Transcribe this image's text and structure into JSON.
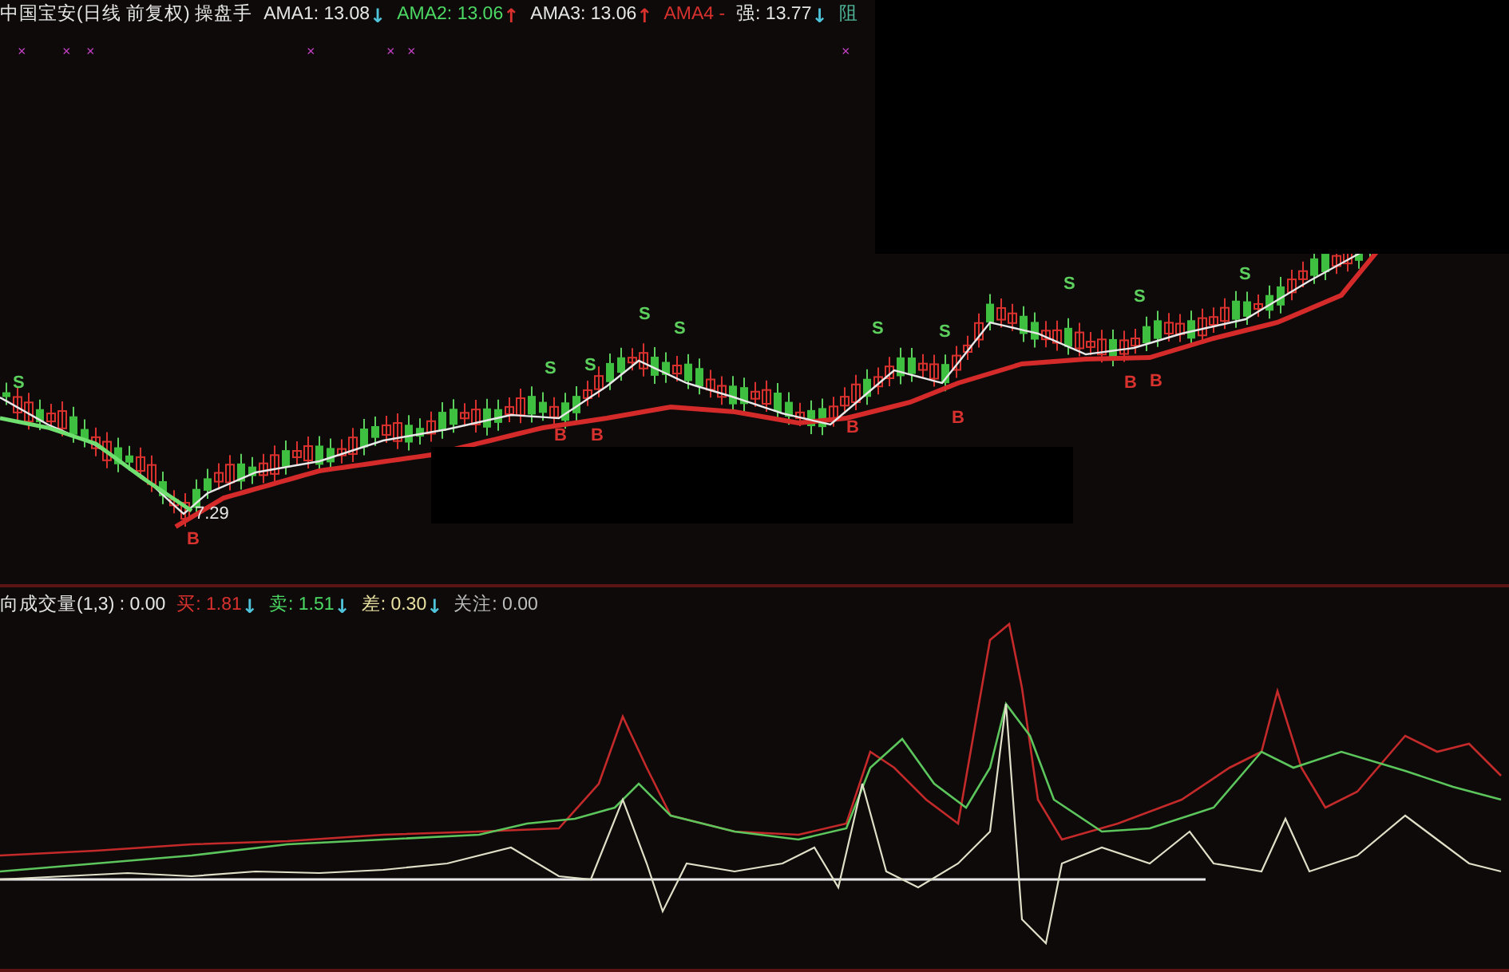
{
  "header": {
    "title": "中国宝安(日线 前复权) 操盘手",
    "indicators": [
      {
        "label": "AMA1: 13.08",
        "color": "#e6e6e6",
        "arrow": {
          "text": "↓",
          "color": "#4fc3d9"
        }
      },
      {
        "label": "AMA2: 13.06",
        "color": "#4cd964",
        "arrow": {
          "text": "↑",
          "color": "#d9322e"
        }
      },
      {
        "label": "AMA3: 13.06",
        "color": "#e6e6e6",
        "arrow": {
          "text": "↑",
          "color": "#d9322e"
        }
      },
      {
        "label": "AMA4 -",
        "color": "#d9322e"
      },
      {
        "label": "强: 13.77",
        "color": "#e6e6e6",
        "arrow": {
          "text": "↓",
          "color": "#4fc3d9"
        }
      },
      {
        "label": "阻",
        "color": "#4fb89a"
      }
    ]
  },
  "price_chart": {
    "low_label": "7.29",
    "markers": [
      {
        "text": "×"
      },
      {
        "text": "×"
      },
      {
        "text": "×"
      },
      {
        "text": "×"
      },
      {
        "text": "×"
      },
      {
        "text": "×"
      },
      {
        "text": "×"
      }
    ],
    "signals": [
      {
        "label": "S",
        "kind": "sell"
      },
      {
        "label": "B",
        "kind": "buy"
      },
      {
        "label": "S",
        "kind": "sell"
      },
      {
        "label": "S",
        "kind": "sell"
      },
      {
        "label": "S",
        "kind": "sell"
      },
      {
        "label": "S",
        "kind": "sell"
      },
      {
        "label": "B",
        "kind": "buy"
      },
      {
        "label": "B",
        "kind": "buy"
      },
      {
        "label": "B",
        "kind": "buy"
      },
      {
        "label": "S",
        "kind": "sell"
      },
      {
        "label": "S",
        "kind": "sell"
      },
      {
        "label": "B",
        "kind": "buy"
      },
      {
        "label": "S",
        "kind": "sell"
      },
      {
        "label": "S",
        "kind": "sell"
      },
      {
        "label": "B",
        "kind": "buy"
      },
      {
        "label": "B",
        "kind": "buy"
      },
      {
        "label": "S",
        "kind": "sell"
      }
    ]
  },
  "volume_header": {
    "title": "向成交量(1,3) : 0.00",
    "indicators": [
      {
        "label": "买: 1.81",
        "color": "#d9322e",
        "arrow": {
          "text": "↓",
          "color": "#4fc3d9"
        }
      },
      {
        "label": "卖: 1.51",
        "color": "#4cd964",
        "arrow": {
          "text": "↓",
          "color": "#4fc3d9"
        }
      },
      {
        "label": "差: 0.30",
        "color": "#e8e0a0",
        "arrow": {
          "text": "↓",
          "color": "#4fc3d9"
        }
      },
      {
        "label": "关注: 0.00",
        "color": "#bdbdbd"
      }
    ]
  }
}
